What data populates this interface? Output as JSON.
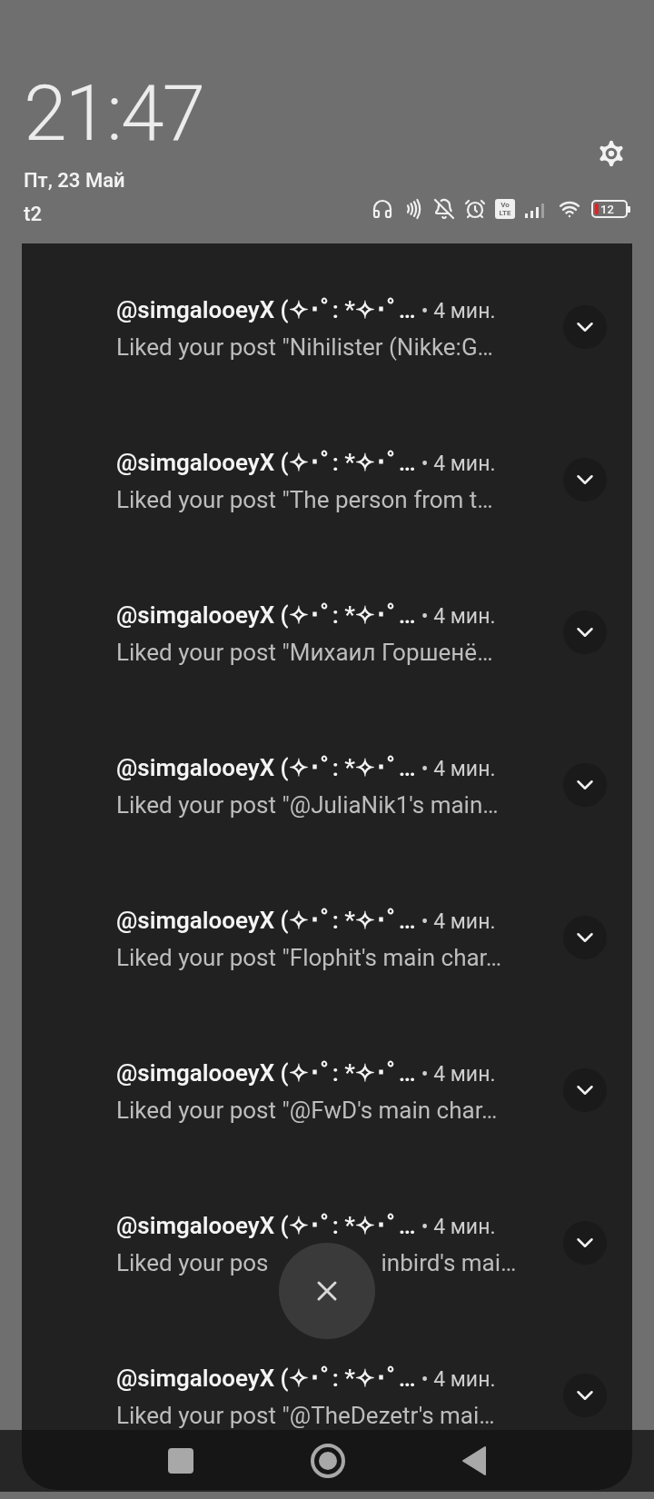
{
  "lock_header": {
    "time": "21:47",
    "date": "Пт, 23 Май",
    "carrier": "t2",
    "volte": [
      "Vo",
      "LTE"
    ],
    "battery": "12"
  },
  "notifications": [
    {
      "kind": "plain",
      "title": "@simgalooeyX (✧･ﾟ: *✧･ﾟ…",
      "time": "• 4 мин.",
      "body": "Liked your post \"Nihilister (Nikke:G…"
    },
    {
      "kind": "plain",
      "title": "@simgalooeyX (✧･ﾟ: *✧･ﾟ…",
      "time": "• 4 мин.",
      "body": "Liked your post \"The person from t…"
    },
    {
      "kind": "plain",
      "title": "@simgalooeyX (✧･ﾟ: *✧･ﾟ…",
      "time": "• 4 мин.",
      "body": "Liked your post \"Михаил Горшенё…"
    },
    {
      "kind": "plain",
      "title": "@simgalooeyX (✧･ﾟ: *✧･ﾟ…",
      "time": "• 4 мин.",
      "body": "Liked your post \"@JuliaNik1's main…"
    },
    {
      "kind": "plain",
      "title": "@simgalooeyX (✧･ﾟ: *✧･ﾟ…",
      "time": "• 4 мин.",
      "body": "Liked your post \"Flophit's main char…"
    },
    {
      "kind": "plain",
      "title": "@simgalooeyX (✧･ﾟ: *✧･ﾟ…",
      "time": "• 4 мин.",
      "body": "Liked your post \"@FwD's main char…"
    },
    {
      "kind": "covered",
      "title": "@simgalooeyX (✧･ﾟ: *✧･ﾟ…",
      "time": "• 4 мин.",
      "body_start": "Liked your pos",
      "body_end": "inbird's mai…"
    },
    {
      "kind": "plain",
      "title": "@simgalooeyX (✧･ﾟ: *✧･ﾟ…",
      "time": "• 4 мин.",
      "body": "Liked your post \"@TheDezetr's mai…"
    }
  ]
}
